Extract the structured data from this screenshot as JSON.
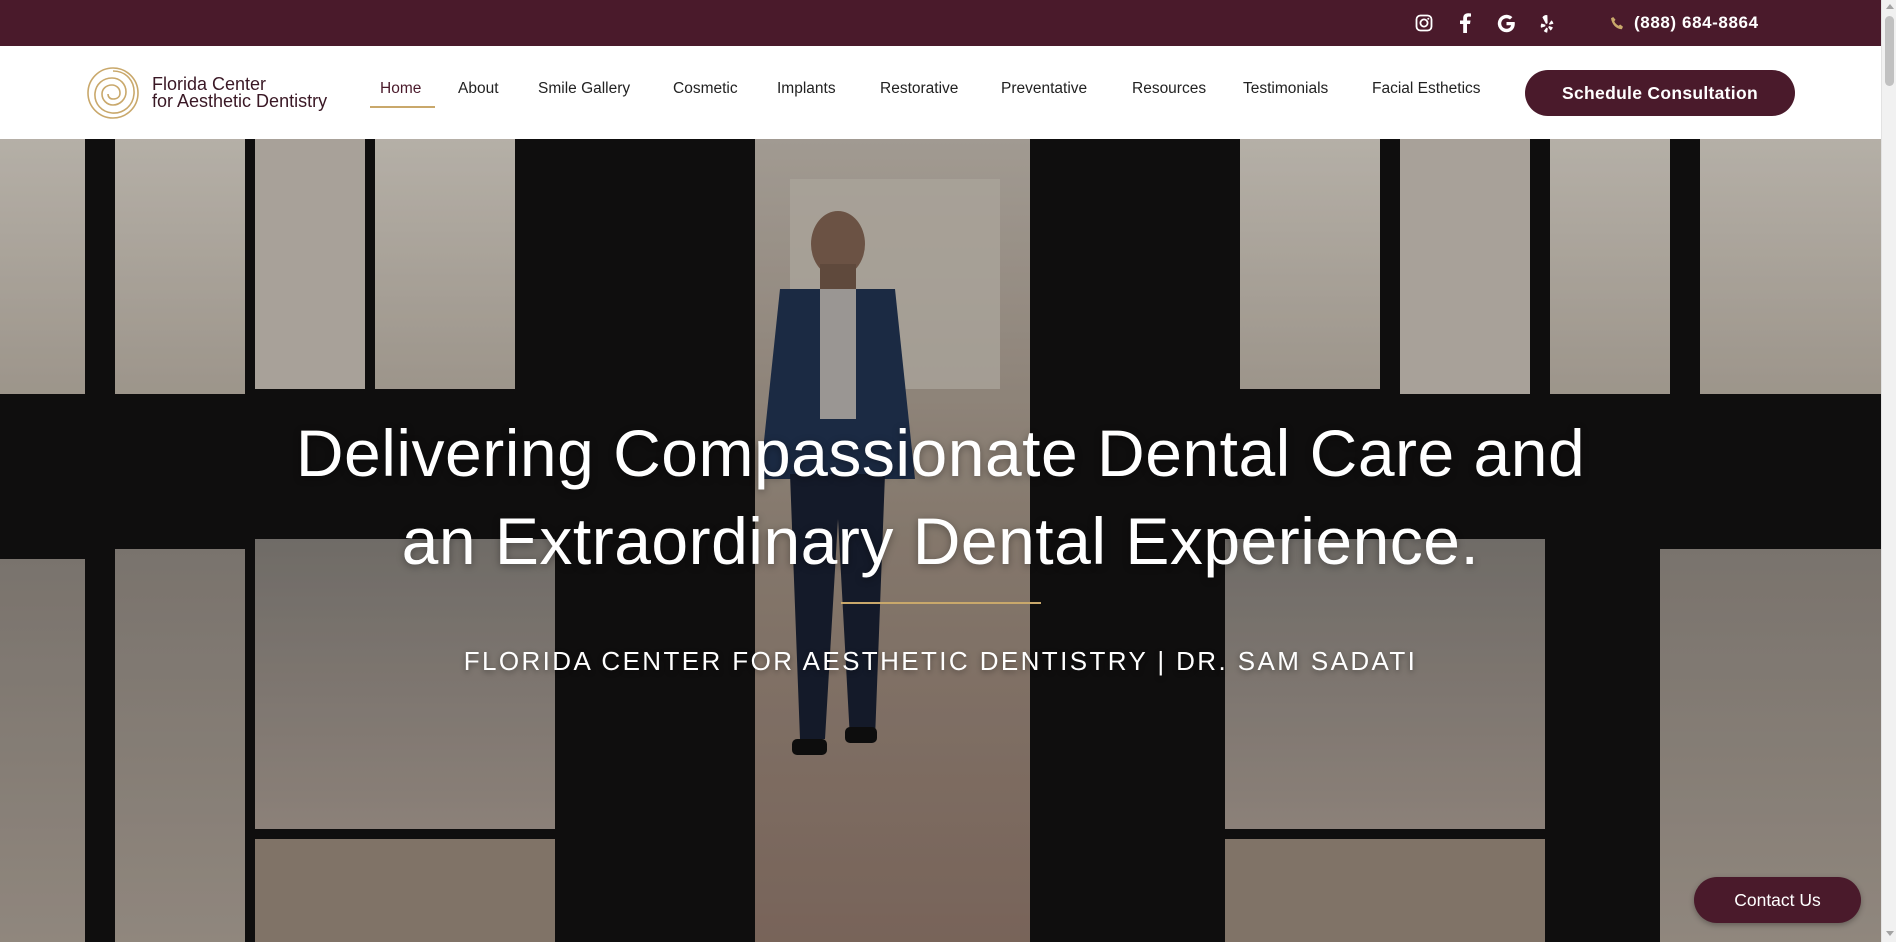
{
  "topbar": {
    "icons": [
      "instagram-icon",
      "facebook-icon",
      "google-icon",
      "yelp-icon"
    ],
    "phone": "(888) 684-8864",
    "background": "#4a1a2b"
  },
  "header": {
    "logo": {
      "line1": "Florida Center",
      "line2": "for Aesthetic Dentistry"
    },
    "nav": [
      {
        "label": "Home",
        "active": true
      },
      {
        "label": "About"
      },
      {
        "label": "Smile Gallery"
      },
      {
        "label": "Cosmetic"
      },
      {
        "label": "Implants"
      },
      {
        "label": "Restorative"
      },
      {
        "label": "Preventative"
      },
      {
        "label": "Resources"
      },
      {
        "label": "Testimonials"
      },
      {
        "label": "Facial Esthetics"
      }
    ],
    "cta": "Schedule Consultation"
  },
  "hero": {
    "title_line1": "Delivering Compassionate Dental Care and",
    "title_line2": "an Extraordinary Dental Experience.",
    "subtitle": "FLORIDA CENTER FOR AESTHETIC DENTISTRY | DR. SAM SADATI"
  },
  "floating": {
    "contact": "Contact Us"
  },
  "colors": {
    "brand": "#4a1a2b",
    "accent_gold": "#c9a86b"
  }
}
